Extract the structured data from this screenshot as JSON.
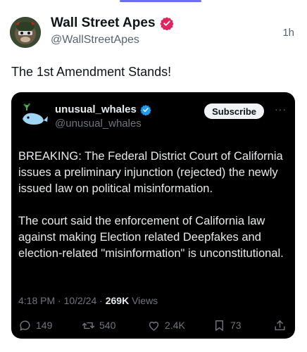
{
  "post": {
    "author_name": "Wall Street Apes",
    "handle": "@WallStreetApes",
    "time": "1h",
    "text": "The 1st Amendment Stands!"
  },
  "quote": {
    "author_name": "unusual_whales",
    "handle": "@unusual_whales",
    "subscribe_label": "Subscribe",
    "more_label": "···",
    "paragraphs": [
      "BREAKING: The Federal District Court of California issues a preliminary injunction (rejected) the newly issued law on political misinformation.",
      "The court said the enforcement of California law against making Election related Deepfakes and election-related \"misinformation\" is unconstitutional."
    ],
    "timestamp": "4:18 PM · 10/2/24 · ",
    "views_count": "269K",
    "views_label": " Views",
    "stats": {
      "replies": "149",
      "reposts": "540",
      "likes": "2.4K",
      "bookmarks": "73"
    }
  },
  "colors": {
    "verified_red": "#e0245e",
    "verified_blue": "#1d9bf0",
    "quote_bg": "#000000"
  },
  "icons": [
    "verified-badge-icon",
    "reply-icon",
    "repost-icon",
    "like-icon",
    "bookmark-icon",
    "share-icon"
  ]
}
